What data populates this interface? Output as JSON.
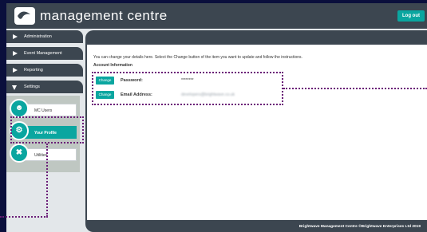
{
  "header": {
    "title": "management centre",
    "logout_label": "Log out",
    "logo_icon": "brightwave-logo-icon"
  },
  "sidebar": {
    "items": [
      {
        "label": "Administration"
      },
      {
        "label": "Event Management"
      },
      {
        "label": "Reporting"
      },
      {
        "label": "Settings"
      }
    ],
    "submenu": [
      {
        "label": "MC Users",
        "icon": "users-icon"
      },
      {
        "label": "Your Profile",
        "icon": "gears-icon"
      },
      {
        "label": "Utilities",
        "icon": "tools-icon"
      }
    ]
  },
  "main": {
    "intro": "You can change your details here. Select the Change button of the item you want to update and follow the instructions.",
    "section_title": "Account Information",
    "fields": [
      {
        "button": "Change",
        "label": "Password:",
        "value": "********"
      },
      {
        "button": "Change",
        "label": "Email Address:",
        "value": "developers@brightwave.co.uk"
      }
    ]
  },
  "footer": {
    "text": "Brightwave Management Centre ©Brightwave Enterprises Ltd 2019"
  },
  "colors": {
    "header": "#3c4650",
    "accent": "#0aa6a0",
    "highlight": "#6b1e78",
    "background": "#0a0f3c"
  }
}
